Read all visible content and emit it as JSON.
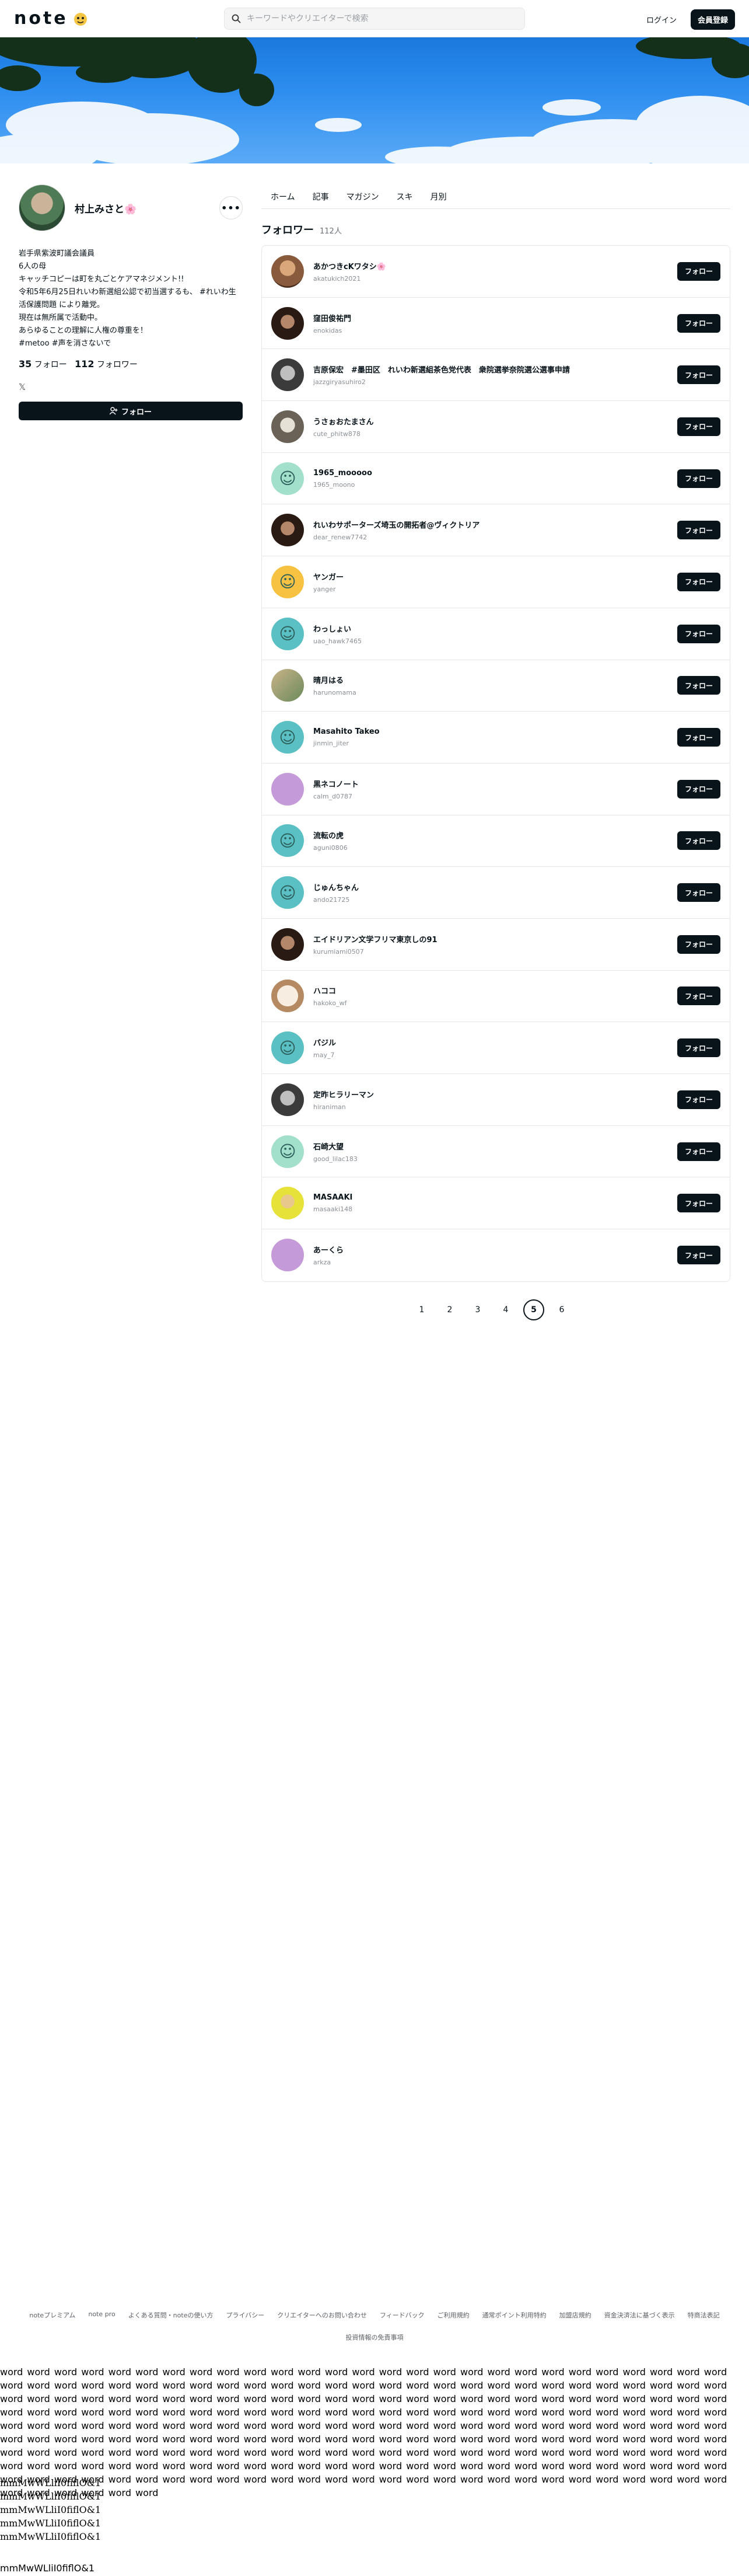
{
  "header": {
    "logo_text": "note",
    "search_placeholder": "キーワードやクリエイターで検索",
    "login_label": "ログイン",
    "signup_label": "会員登録"
  },
  "profile": {
    "name": "村上みさと🌸",
    "more_label": "•••",
    "bio": "岩手県紫波町議会議員\n6人の母\nキャッチコピーは町を丸ごとケアマネジメント!!\n令和5年6月25日れいわ新選組公認で初当選するも、 #れいわ生活保護問題 により離党。\n現在は無所属で活動中。\nあらゆることの理解に人権の尊重を！\n#metoo #声を消さないで",
    "following_count": "35",
    "following_label": "フォロー",
    "followers_count": "112",
    "followers_label": "フォロワー",
    "follow_button_label": "フォロー"
  },
  "tabs": [
    "ホーム",
    "記事",
    "マガジン",
    "スキ",
    "月別"
  ],
  "followers_section": {
    "title": "フォロワー",
    "count_label": "112人",
    "follow_label": "フォロー",
    "users": [
      {
        "name": "あかつきcKワタシ🌸",
        "id": "akatukich2021",
        "avatar": "photo-warm"
      },
      {
        "name": "窪田俊祐門",
        "id": "enokidas",
        "avatar": "photo-dark"
      },
      {
        "name": "吉原保宏　#墨田区　れいわ新選組茶色党代表　衆院選挙奈院選公選事申請",
        "id": "jazzgiryasuhiro2",
        "avatar": "photo-gray"
      },
      {
        "name": "うさぉおたまさん",
        "id": "cute_phitw878",
        "avatar": "photo-sketch"
      },
      {
        "name": "1965_mooooo",
        "id": "1965_moono",
        "avatar": "default-mint"
      },
      {
        "name": "れいわサポーターズ埼玉の開拓者@ヴィクトリア",
        "id": "dear_renew7742",
        "avatar": "photo-dark"
      },
      {
        "name": "ヤンガー",
        "id": "yanger",
        "avatar": "default-yellow"
      },
      {
        "name": "わっしょい",
        "id": "uao_hawk7465",
        "avatar": "default-teal"
      },
      {
        "name": "晴月はる",
        "id": "harunomama",
        "avatar": "photo-map"
      },
      {
        "name": "Masahito Takeo",
        "id": "jinmin_jiter",
        "avatar": "default-teal"
      },
      {
        "name": "黒ネコノート",
        "id": "calm_d0787",
        "avatar": "photo-purple"
      },
      {
        "name": "流転の虎",
        "id": "aguni0806",
        "avatar": "default-teal"
      },
      {
        "name": "じゅんちゃん",
        "id": "ando21725",
        "avatar": "default-teal"
      },
      {
        "name": "エイドリアン文学フリマ東京しの91",
        "id": "kurumiami0507",
        "avatar": "photo-dark"
      },
      {
        "name": "ハココ",
        "id": "hakoko_wf",
        "avatar": "photo-illust"
      },
      {
        "name": "パジル",
        "id": "may_7",
        "avatar": "default-teal"
      },
      {
        "name": "定昨ヒラリーマン",
        "id": "hiraniman",
        "avatar": "photo-gray"
      },
      {
        "name": "石崎大望",
        "id": "good_lilac183",
        "avatar": "default-mint"
      },
      {
        "name": "MASAAKI",
        "id": "masaaki148",
        "avatar": "photo-yellow"
      },
      {
        "name": "あーくら",
        "id": "arkza",
        "avatar": "photo-purple"
      }
    ]
  },
  "pagination": {
    "pages": [
      "1",
      "2",
      "3",
      "4",
      "5",
      "6"
    ],
    "current": "5"
  },
  "footer": {
    "links": [
      "noteプレミアム",
      "note pro",
      "よくある質問・noteの使い方",
      "プライバシー",
      "クリエイターへのお問い合わせ",
      "フィードバック",
      "ご利用規約",
      "通常ポイント利用特約",
      "加盟店規約",
      "資金決済法に基づく表示",
      "特商法表記"
    ],
    "company": "投資情報の免責事項"
  },
  "filler": {
    "words": "word word word word word word word word word word word word word word word word word word word word word word word word word word word word word word word word word word word word word word word word word word word word word word word word word word word word word word word word word word word word word word word word word word word word word word word word word word word word word word word word word word word word word word word word word word word word word word word word word word word word word word word word word word word word word word word word word word word word word word word word word word word word word word word word word word word word word word word word word word word word word word word word word word word word word word word word word word word word word word word word word word word word word word word word word word word word word word word word word word word word word word word word word word word word word word word word word word word word word word word word word word word word word word word word word word word word word word word word word word word word word word word word word word word word word word word word word word word word word word word word word word word word word word word word word",
    "glyph_lines": [
      "mmMwWLliI0fiflO&1",
      "mmMwWLliI0fiflO&1",
      "mmMwWLliI0fiflO&1",
      "mmMwWLliI0fiflO&1",
      "mmMwWLliI0fiflO&1"
    ],
    "last_line": "mmMwWLliI0fiflO&1"
  },
  "colors": {
    "primary": "#08131a",
    "hero_sky": "#1a78de",
    "avatar_teal": "#5bc0c4",
    "avatar_mint": "#a3e0cb"
  }
}
